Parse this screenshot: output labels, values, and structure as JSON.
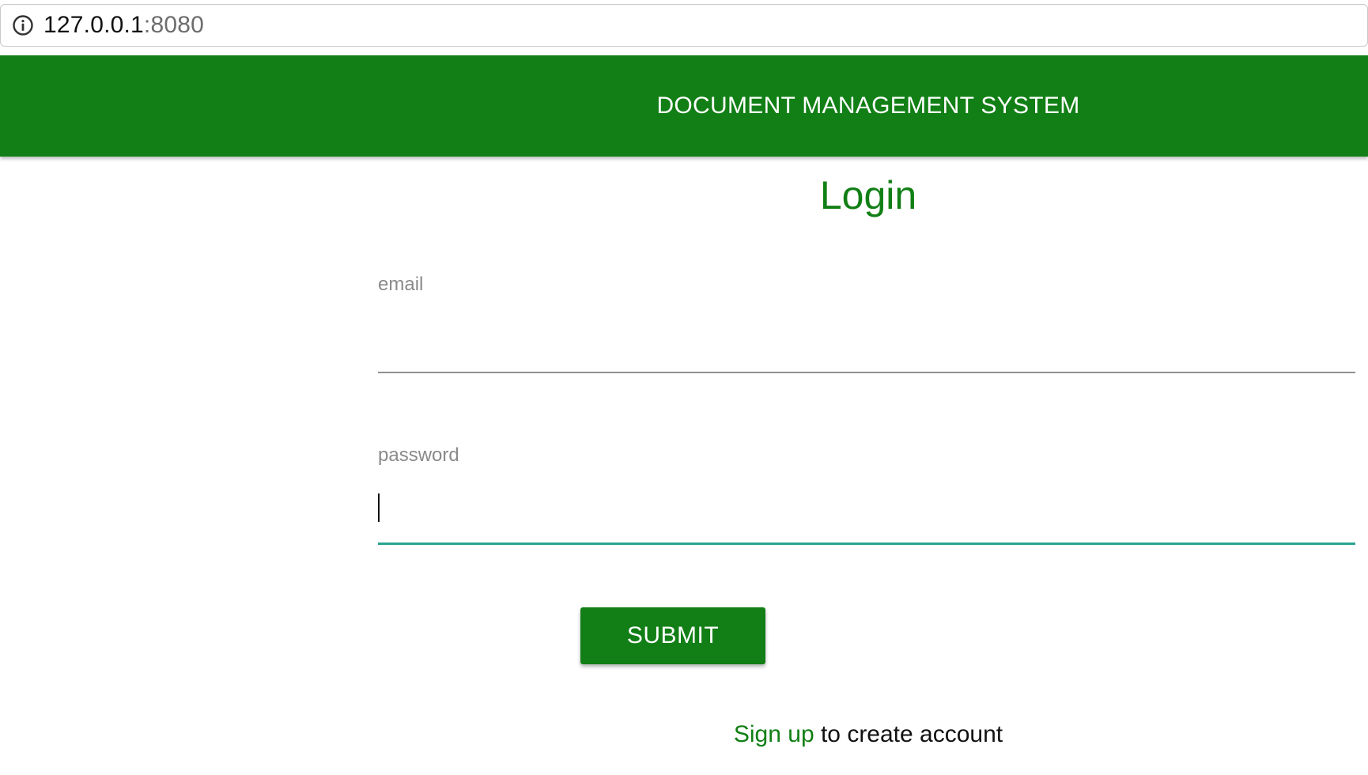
{
  "browser": {
    "url_host": "127.0.0.1",
    "url_port": ":8080",
    "info_icon": "info-circle-icon"
  },
  "header": {
    "title": "DOCUMENT MANAGEMENT SYSTEM",
    "background_color": "#117f15"
  },
  "login": {
    "heading": "Login",
    "email_label": "email",
    "email_value": "",
    "password_label": "password",
    "password_value": "",
    "submit_label": "SUBMIT",
    "signup_link": "Sign up",
    "signup_text": " to create account"
  },
  "colors": {
    "primary": "#117f15",
    "focus_underline": "#2aa48f",
    "label": "#8a8a8a"
  }
}
